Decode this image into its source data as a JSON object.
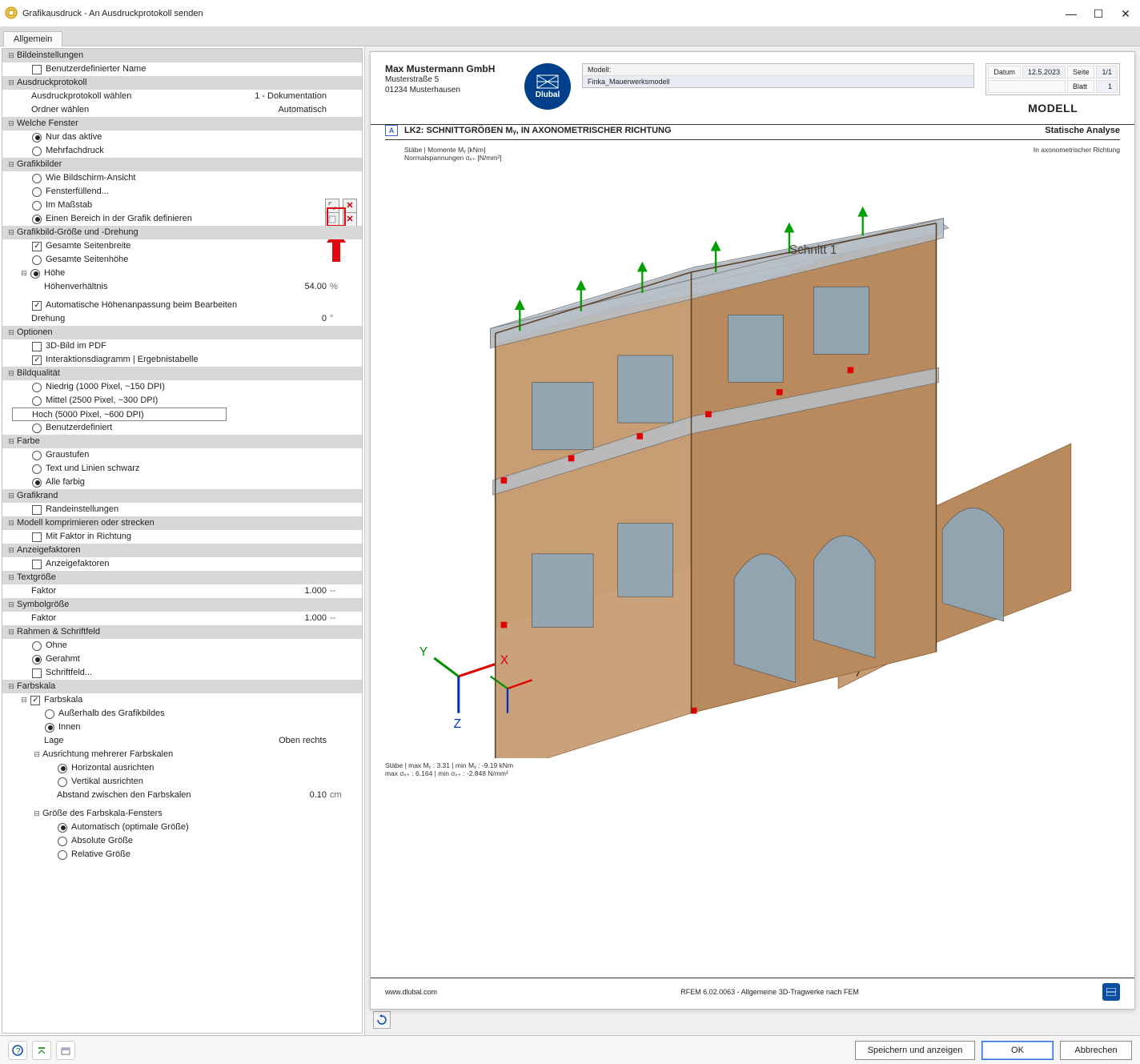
{
  "window": {
    "title": "Grafikausdruck - An Ausdruckprotokoll senden",
    "tab": "Allgemein"
  },
  "tree": {
    "bildeinstellungen": "Bildeinstellungen",
    "benutzerdef_name": "Benutzerdefinierter Name",
    "ausdruckprotokoll": "Ausdruckprotokoll",
    "ausdruck_waehlen": "Ausdruckprotokoll wählen",
    "ausdruck_waehlen_val": "1 - Dokumentation",
    "ordner_waehlen": "Ordner wählen",
    "ordner_waehlen_val": "Automatisch",
    "welche_fenster": "Welche Fenster",
    "nur_das_aktive": "Nur das aktive",
    "mehrfachdruck": "Mehrfachdruck",
    "grafikbilder": "Grafikbilder",
    "wie_bildschirm": "Wie Bildschirm-Ansicht",
    "fensterfuellend": "Fensterfüllend...",
    "im_massstab": "Im Maßstab",
    "bereich_def": "Einen Bereich in der Grafik definieren",
    "grafik_groesse": "Grafikbild-Größe und -Drehung",
    "gesamte_seitenbreite": "Gesamte Seitenbreite",
    "gesamte_seitenhoehe": "Gesamte Seitenhöhe",
    "hoehe": "Höhe",
    "hoehenverhaeltnis": "Höhenverhältnis",
    "hoehenverhaeltnis_val": "54.00",
    "hoehenverhaeltnis_unit": "%",
    "auto_hoehe": "Automatische Höhenanpassung beim Bearbeiten",
    "drehung": "Drehung",
    "drehung_val": "0",
    "drehung_unit": "°",
    "optionen": "Optionen",
    "dreid_im_pdf": "3D-Bild im PDF",
    "interaktionsdiagramm": "Interaktionsdiagramm | Ergebnistabelle",
    "bildqualitaet": "Bildqualität",
    "bq_niedrig": "Niedrig (1000 Pixel, ~150 DPI)",
    "bq_mittel": "Mittel (2500 Pixel, ~300 DPI)",
    "bq_hoch": "Hoch (5000 Pixel, ~600 DPI)",
    "bq_user": "Benutzerdefiniert",
    "farbe": "Farbe",
    "graustufen": "Graustufen",
    "text_linien_schwarz": "Text und Linien schwarz",
    "alle_farbig": "Alle farbig",
    "grafikrand": "Grafikrand",
    "randeinstellungen": "Randeinstellungen",
    "modell_komprim": "Modell komprimieren oder strecken",
    "mit_faktor": "Mit Faktor in Richtung",
    "anzeigefaktoren": "Anzeigefaktoren",
    "anzeigefaktoren_sub": "Anzeigefaktoren",
    "textgroesse": "Textgröße",
    "textgroesse_faktor": "Faktor",
    "textgroesse_val": "1.000",
    "textgroesse_unit": "--",
    "symbolgroesse": "Symbolgröße",
    "symbolgroesse_faktor": "Faktor",
    "symbolgroesse_val": "1.000",
    "symbolgroesse_unit": "--",
    "rahmen": "Rahmen & Schriftfeld",
    "rahmen_ohne": "Ohne",
    "rahmen_gerahmt": "Gerahmt",
    "rahmen_schriftfeld": "Schriftfeld...",
    "farbskala": "Farbskala",
    "farbskala_chk": "Farbskala",
    "farbskala_ausserhalb": "Außerhalb des Grafikbildes",
    "farbskala_innen": "Innen",
    "farbskala_lage": "Lage",
    "farbskala_lage_val": "Oben rechts",
    "ausrichtung": "Ausrichtung mehrerer Farbskalen",
    "ausr_horizontal": "Horizontal ausrichten",
    "ausr_vertikal": "Vertikal ausrichten",
    "abstand": "Abstand zwischen den Farbskalen",
    "abstand_val": "0.10",
    "abstand_unit": "cm",
    "fenster_groesse": "Größe des Farbskala-Fensters",
    "fenster_auto": "Automatisch (optimale Größe)",
    "fenster_absolut": "Absolute Größe",
    "fenster_relativ": "Relative Größe"
  },
  "preview": {
    "company": "Max Mustermann GmbH",
    "street": "Musterstraße 5",
    "city": "01234 Musterhausen",
    "logo_text": "Dlubal",
    "model_label": "Modell:",
    "model_name": "Finka_Mauerwerksmodell",
    "date_label": "Datum",
    "date_val": "12.5.2023",
    "page_label": "Seite",
    "page_val": "1/1",
    "sheet_label": "Blatt",
    "sheet_val": "1",
    "big_title": "MODELL",
    "section_badge": "A",
    "section_title": "LK2: SCHNITTGRÖẞEN Mᵧ, IN AXONOMETRISCHER RICHTUNG",
    "section_right": "Statische Analyse",
    "sub_left1": "Stäbe | Momente Mᵧ [kNm]",
    "sub_left2": "Normalspannungen σₓ₊ [N/mm²]",
    "sub_right": "In axonometrischer Richtung",
    "schnitt_label": "Schnitt 1",
    "bottom1": "Stäbe | max Mᵧ : 3.31 | min Mᵧ : -9.19 kNm",
    "bottom2": "max σₓ₊ : 6.164 | min σₓ₊ : -2.848 N/mm²",
    "footer_url": "www.dlubal.com",
    "footer_center": "RFEM 6.02.0063 - Allgemeine 3D-Tragwerke nach FEM"
  },
  "buttons": {
    "save_show": "Speichern und anzeigen",
    "ok": "OK",
    "cancel": "Abbrechen"
  }
}
